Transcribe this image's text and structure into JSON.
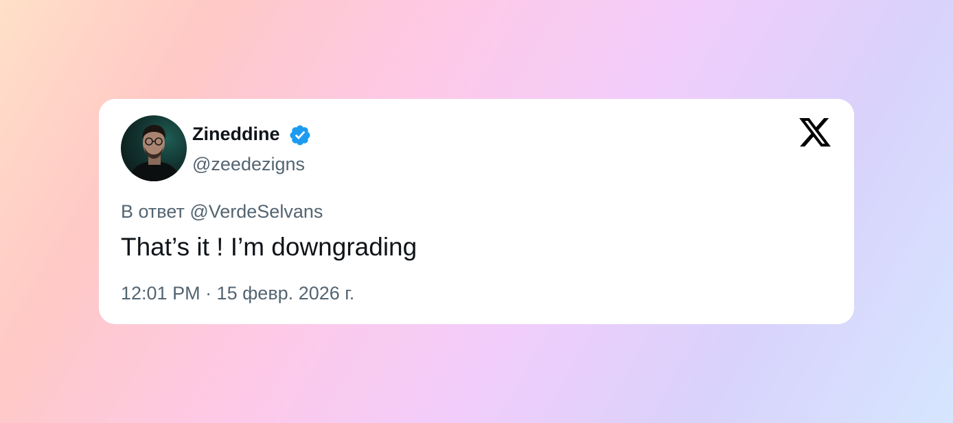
{
  "tweet": {
    "author": {
      "display_name": "Zineddine",
      "handle": "@zeedezigns",
      "verified": true,
      "verified_icon": "verified-badge-icon",
      "avatar": "profile-photo"
    },
    "reply_to": "В ответ @VerdeSelvans",
    "text": "That’s it ! I’m downgrading",
    "timestamp": "12:01 PM · 15 февр. 2026 г.",
    "platform_icon": "x-logo-icon"
  },
  "colors": {
    "primary_text": "#0f1419",
    "secondary_text": "#536471",
    "verified_blue": "#1d9bf0",
    "card_background": "#ffffff"
  }
}
